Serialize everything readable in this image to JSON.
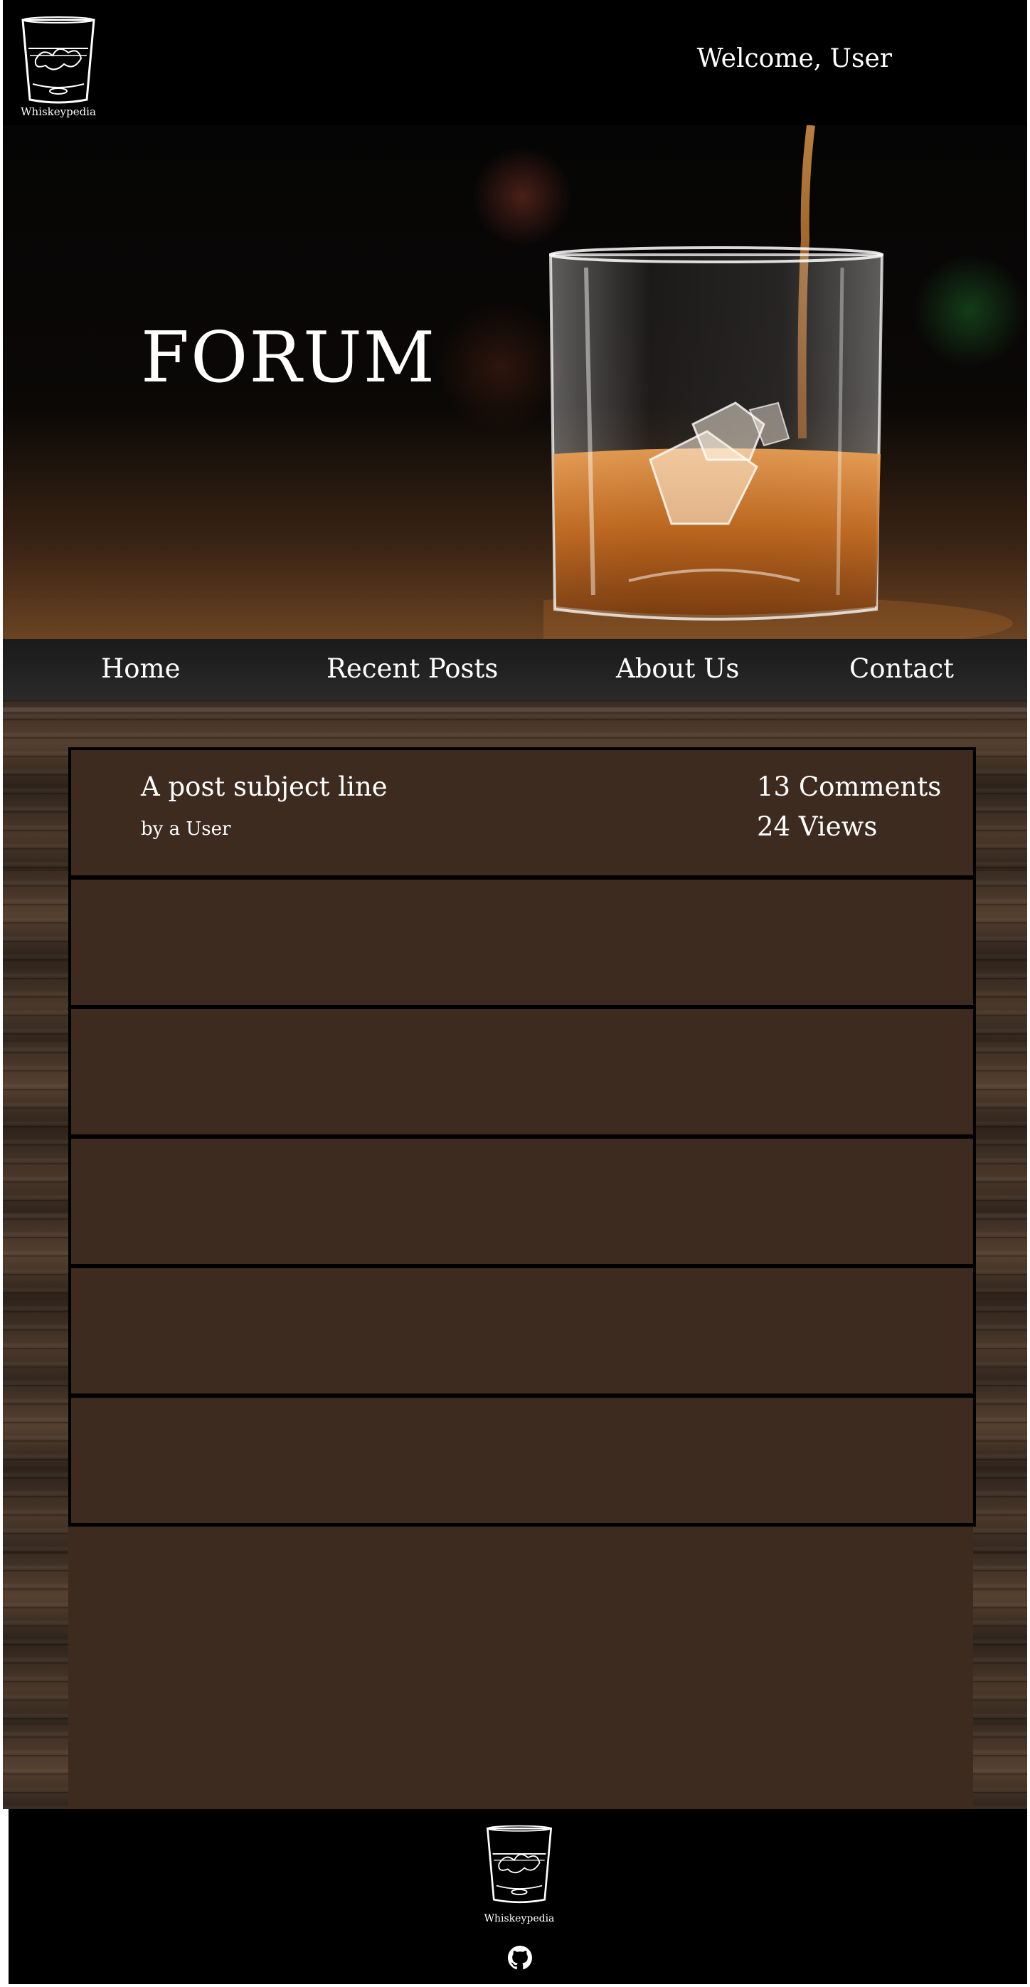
{
  "brand": {
    "name": "Whiskeypedia"
  },
  "header": {
    "welcome": "Welcome, User"
  },
  "hero": {
    "title": "FORUM"
  },
  "nav": {
    "items": [
      {
        "label": "Home"
      },
      {
        "label": "Recent Posts"
      },
      {
        "label": "About Us"
      },
      {
        "label": "Contact"
      }
    ]
  },
  "posts": [
    {
      "subject": "A post subject line",
      "author": "by a User",
      "comments": "13 Comments",
      "views": "24 Views"
    }
  ],
  "footer": {
    "logo_text": "Whiskeypedia",
    "icons": [
      "glass-logo-icon",
      "github-icon"
    ]
  },
  "colors": {
    "header_bg": "#000000",
    "panel_bg": "#3e2b1f",
    "border": "#000000",
    "text": "#ffffff"
  }
}
